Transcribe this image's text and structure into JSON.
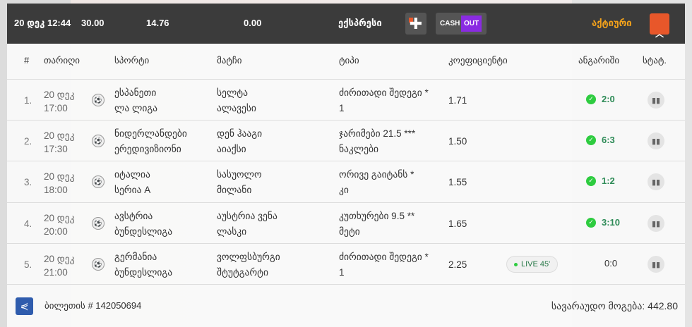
{
  "topbar": {
    "datetime": "20 დეკ 12:44",
    "stake": "30.00",
    "total_odds": "14.76",
    "win": "0.00",
    "bet_type": "ექსპრესი",
    "cash": "CASH",
    "out": "OUT",
    "status": "აქტიური",
    "collapse_icon": "chevron-up"
  },
  "headers": {
    "num": "#",
    "date": "თარიღი",
    "sport": "სპორტი",
    "match": "მატჩი",
    "type": "ტიპი",
    "odds": "კოეფიციენტი",
    "score": "ანგარიში",
    "stat": "სტატ."
  },
  "rows": [
    {
      "num": "1.",
      "date": "20 დეკ",
      "time": "17:00",
      "sport1": "ესპანეთი",
      "sport2": "ლა ლიგა",
      "match1": "სელტა",
      "match2": "ალავესი",
      "type1": "ძირითადი შედეგი *",
      "type2": "1",
      "odds": "1.71",
      "score": "2:0"
    },
    {
      "num": "2.",
      "date": "20 დეკ",
      "time": "17:30",
      "sport1": "ნიდერლანდები",
      "sport2": "ერედივიზიონი",
      "match1": "დენ ჰააგი",
      "match2": "აიაქსი",
      "type1": "ჯარიმები 21.5 ***",
      "type2": "ნაკლები",
      "odds": "1.50",
      "score": "6:3"
    },
    {
      "num": "3.",
      "date": "20 დეკ",
      "time": "18:00",
      "sport1": "იტალია",
      "sport2": "სერია A",
      "match1": "სასუოლო",
      "match2": "მილანი",
      "type1": "ორივე გაიტანს *",
      "type2": "კი",
      "odds": "1.55",
      "score": "1:2"
    },
    {
      "num": "4.",
      "date": "20 დეკ",
      "time": "20:00",
      "sport1": "ავსტრია",
      "sport2": "ბუნდესლიგა",
      "match1": "აუსტრია ვენა",
      "match2": "ლასკი",
      "type1": "კუთხურები 9.5 **",
      "type2": "მეტი",
      "odds": "1.65",
      "score": "3:10"
    },
    {
      "num": "5.",
      "date": "20 დეკ",
      "time": "21:00",
      "sport1": "გერმანია",
      "sport2": "ბუნდესლიგა",
      "match1": "ვოლფსბურგი",
      "match2": "შტუტგარტი",
      "type1": "ძირითადი შედეგი *",
      "type2": "1",
      "odds": "2.25",
      "score": "0:0",
      "live": "LIVE 45'"
    }
  ],
  "footer": {
    "ticket": "ბილეთის # 142050694",
    "payout": "სავარაუდო მოგება: 442.80"
  },
  "colors": {
    "accent": "#e8572a",
    "status": "#f3a21b",
    "cashout": "#8a2be2",
    "win": "#2ecc40"
  }
}
